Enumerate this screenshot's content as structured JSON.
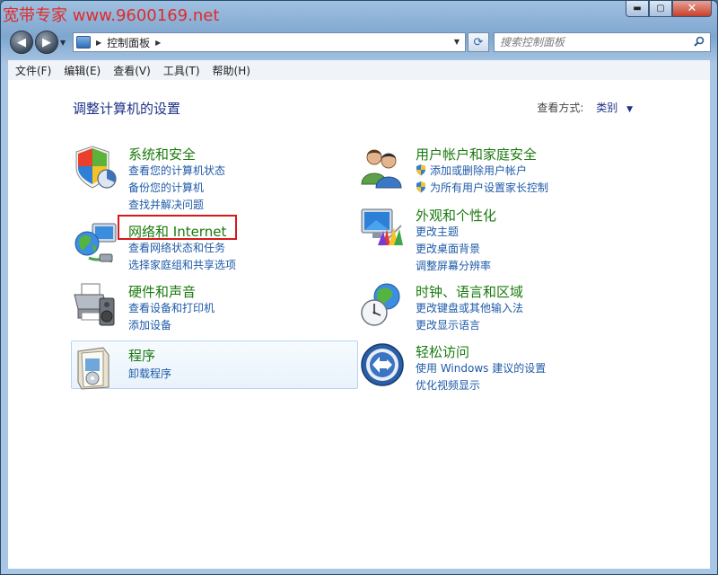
{
  "watermark": "宽带专家 www.9600169.net",
  "window_buttons": {
    "minimize": "▬",
    "maximize": "▢",
    "close": "✕"
  },
  "nav": {
    "back": "◀",
    "forward": "▶"
  },
  "address": {
    "path": "控制面板"
  },
  "search": {
    "placeholder": "搜索控制面板"
  },
  "menu": [
    "文件(F)",
    "编辑(E)",
    "查看(V)",
    "工具(T)",
    "帮助(H)"
  ],
  "heading": "调整计算机的设置",
  "view_by": {
    "label": "查看方式:",
    "value": "类别"
  },
  "categories": {
    "system_security": {
      "icon": "shield-chart-icon",
      "title": "系统和安全",
      "links": [
        "查看您的计算机状态",
        "备份您的计算机",
        "查找并解决问题"
      ]
    },
    "network_internet": {
      "icon": "globe-network-icon",
      "title": "网络和 Internet",
      "links": [
        "查看网络状态和任务",
        "选择家庭组和共享选项"
      ]
    },
    "hardware_sound": {
      "icon": "printer-speaker-icon",
      "title": "硬件和声音",
      "links": [
        "查看设备和打印机",
        "添加设备"
      ]
    },
    "programs": {
      "icon": "programs-box-icon",
      "title": "程序",
      "links": [
        "卸载程序"
      ]
    },
    "user_accounts": {
      "icon": "users-icon",
      "title": "用户帐户和家庭安全",
      "links": [
        "添加或删除用户帐户",
        "为所有用户设置家长控制"
      ]
    },
    "appearance": {
      "icon": "monitor-palette-icon",
      "title": "外观和个性化",
      "links": [
        "更改主题",
        "更改桌面背景",
        "调整屏幕分辨率"
      ]
    },
    "clock_region": {
      "icon": "clock-globe-icon",
      "title": "时钟、语言和区域",
      "links": [
        "更改键盘或其他输入法",
        "更改显示语言"
      ]
    },
    "ease_access": {
      "icon": "ease-of-access-icon",
      "title": "轻松访问",
      "links": [
        "使用 Windows 建议的设置",
        "优化视频显示"
      ]
    }
  },
  "colors": {
    "title_green": "#1a7a0e",
    "link_blue": "#1e5aa8",
    "heading_blue": "#1e3287",
    "highlight_red": "#d61a1a"
  }
}
